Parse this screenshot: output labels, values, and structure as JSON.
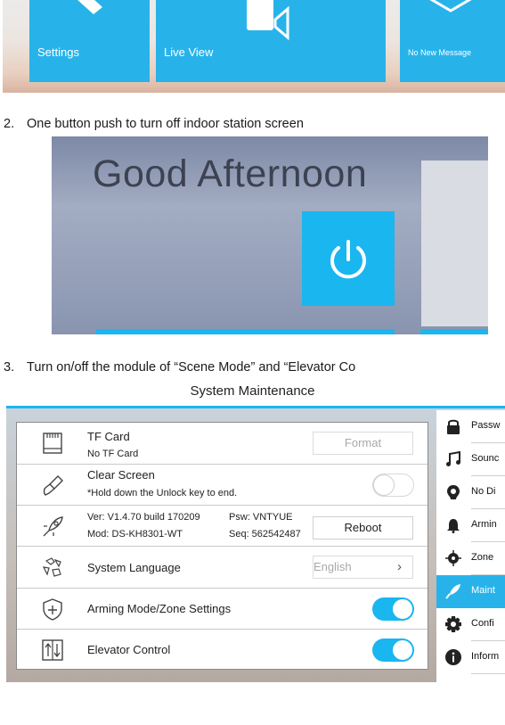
{
  "home_tiles": [
    {
      "label": "Settings",
      "icon": "wrench-icon"
    },
    {
      "label": "Live View",
      "icon": "camera-icon"
    },
    {
      "label": "No New Message",
      "icon": "envelope-icon"
    }
  ],
  "caption2": {
    "number": "2.",
    "text": "One button push to turn off indoor station screen"
  },
  "screen_off": {
    "greeting": "Good Afternoon",
    "icon": "power-icon"
  },
  "caption3": {
    "number": "3.",
    "text": "Turn on/off the module of “Scene Mode” and “Elevator Co"
  },
  "maintenance": {
    "title": "System Maintenance",
    "tf_card": {
      "title": "TF Card",
      "status": "No TF Card",
      "button": "Format"
    },
    "clear_screen": {
      "title": "Clear Screen",
      "hint": "*Hold down the Unlock key to end.",
      "toggle": "off"
    },
    "device": {
      "ver": "Ver: V1.4.70 build 170209",
      "psw": "Psw: VNTYUE",
      "mod": "Mod: DS-KH8301-WT",
      "seq": "Seq: 562542487",
      "button": "Reboot"
    },
    "language": {
      "title": "System Language",
      "value": "English"
    },
    "arming": {
      "title": "Arming Mode/Zone Settings",
      "toggle": "on"
    },
    "elevator": {
      "title": "Elevator Control",
      "toggle": "on"
    }
  },
  "sidebar": [
    {
      "label": "Passw",
      "icon": "lock-icon"
    },
    {
      "label": "Sounc",
      "icon": "music-note-icon"
    },
    {
      "label": "No Di",
      "icon": "do-not-disturb-icon"
    },
    {
      "label": "Armin",
      "icon": "bell-icon"
    },
    {
      "label": "Zone",
      "icon": "zone-target-icon"
    },
    {
      "label": "Maint",
      "icon": "rocket-icon",
      "active": true
    },
    {
      "label": "Confi",
      "icon": "gear-icon"
    },
    {
      "label": "Inform",
      "icon": "info-icon"
    }
  ],
  "colors": {
    "accent": "#1ab6ef",
    "tile": "#27b3ea"
  }
}
